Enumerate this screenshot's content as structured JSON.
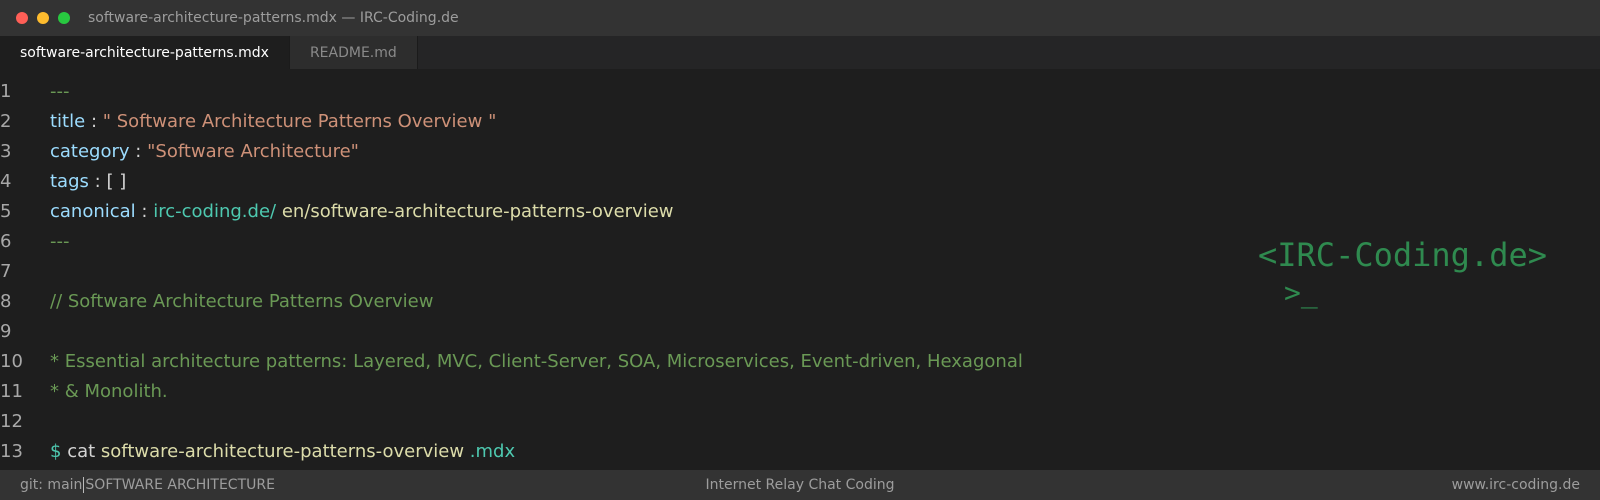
{
  "window": {
    "title": "software-architecture-patterns.mdx — IRC-Coding.de"
  },
  "tabs": [
    {
      "label": "software-architecture-patterns.mdx",
      "active": true
    },
    {
      "label": "README.md",
      "active": false
    }
  ],
  "editor": {
    "line_numbers": [
      "1",
      "2",
      "3",
      "4",
      "5",
      "6",
      "7",
      "8",
      "9",
      "10",
      "11",
      "12",
      "13"
    ],
    "line1": {
      "dash": "---"
    },
    "line2": {
      "key": "title",
      "colon": ":",
      "value": "\" Software Architecture Patterns Overview \""
    },
    "line3": {
      "key": "category",
      "colon": ":",
      "value": "\"Software Architecture\""
    },
    "line4": {
      "key": "tags",
      "colon": ":",
      "value": "[ ]"
    },
    "line5": {
      "key": "canonical",
      "colon": ":",
      "url": "irc-coding.de/",
      "path": "en/software-architecture-patterns-overview"
    },
    "line6": {
      "dash": "---"
    },
    "line8": {
      "comment": "// Software Architecture Patterns Overview"
    },
    "line10": {
      "comment": "* Essential architecture patterns: Layered, MVC, Client-Server, SOA, Microservices, Event-driven, Hexagonal"
    },
    "line11": {
      "comment": "* & Monolith."
    },
    "line13": {
      "prompt": "$",
      "command": "cat",
      "file": "software-architecture-patterns-overview",
      "ext": ".mdx"
    }
  },
  "logo": {
    "text": "<IRC-Coding.de>",
    "prompt": ">_"
  },
  "statusbar": {
    "branch": "git: main",
    "category": "SOFTWARE ARCHITECTURE",
    "center": "Internet Relay Chat Coding",
    "right": "www.irc-coding.de"
  },
  "colors": {
    "background": "#1e1e1e",
    "titlebar": "#333333",
    "key": "#9cdcfe",
    "string": "#ce9178",
    "comment": "#6a9955",
    "url": "#4ec9b0",
    "path": "#dcdcaa",
    "logo": "#2f8a4f"
  },
  "icons": [
    "close-dot",
    "minimize-dot",
    "maximize-dot"
  ]
}
